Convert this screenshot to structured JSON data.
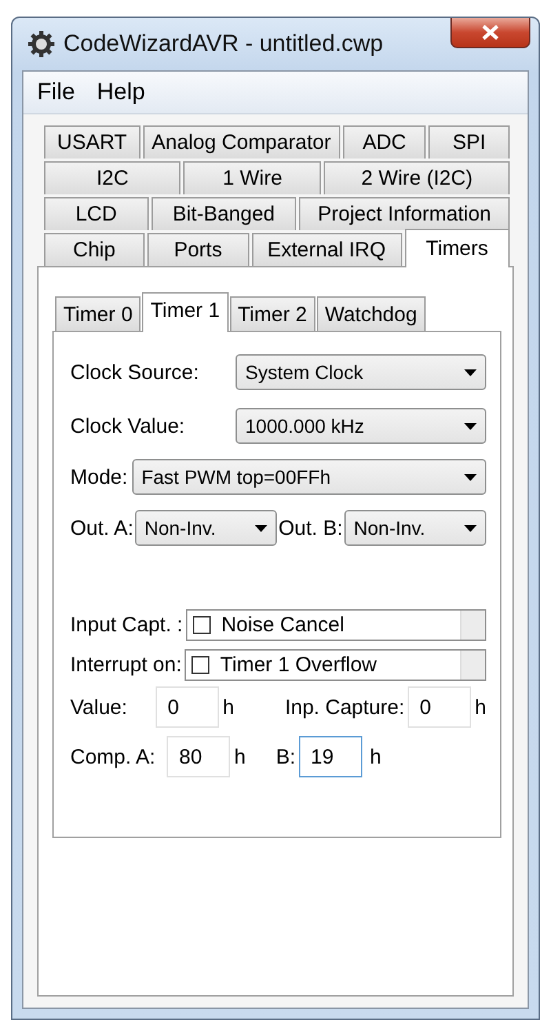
{
  "window": {
    "title": "CodeWizardAVR - untitled.cwp"
  },
  "menu": [
    "File",
    "Help"
  ],
  "tab_rows": [
    [
      {
        "label": "USART",
        "selected": false
      },
      {
        "label": "Analog Comparator",
        "selected": false
      },
      {
        "label": "ADC",
        "selected": false
      },
      {
        "label": "SPI",
        "selected": false
      }
    ],
    [
      {
        "label": "I2C",
        "selected": false
      },
      {
        "label": "1 Wire",
        "selected": false
      },
      {
        "label": "2 Wire (I2C)",
        "selected": false
      }
    ],
    [
      {
        "label": "LCD",
        "selected": false
      },
      {
        "label": "Bit-Banged",
        "selected": false
      },
      {
        "label": "Project Information",
        "selected": false
      }
    ],
    [
      {
        "label": "Chip",
        "selected": false
      },
      {
        "label": "Ports",
        "selected": false
      },
      {
        "label": "External IRQ",
        "selected": false
      },
      {
        "label": "Timers",
        "selected": true
      }
    ]
  ],
  "timer_tabs": [
    {
      "label": "Timer 0",
      "selected": false
    },
    {
      "label": "Timer 1",
      "selected": true
    },
    {
      "label": "Timer 2",
      "selected": false
    },
    {
      "label": "Watchdog",
      "selected": false
    }
  ],
  "clock_source": {
    "label": "Clock Source:",
    "value": "System Clock"
  },
  "clock_value": {
    "label": "Clock Value:",
    "value": "1000.000 kHz"
  },
  "mode": {
    "label": "Mode:",
    "value": "Fast PWM top=00FFh"
  },
  "out_a": {
    "label": "Out. A:",
    "value": "Non-Inv."
  },
  "out_b": {
    "label": "Out. B:",
    "value": "Non-Inv."
  },
  "input_capt": {
    "label": "Input Capt. :",
    "option": "Noise Cancel",
    "checked": false
  },
  "interrupt_on": {
    "label": "Interrupt on:",
    "option": "Timer 1 Overflow",
    "checked": false
  },
  "value": {
    "label": "Value:",
    "value": "0",
    "unit": "h",
    "focused": false
  },
  "inp_capture": {
    "label": "Inp. Capture:",
    "value": "0",
    "unit": "h",
    "focused": false
  },
  "comp_a": {
    "label": "Comp. A:",
    "value": "80",
    "unit": "h",
    "focused": false
  },
  "comp_b": {
    "label": "B:",
    "value": "19",
    "unit": "h",
    "focused": true
  }
}
